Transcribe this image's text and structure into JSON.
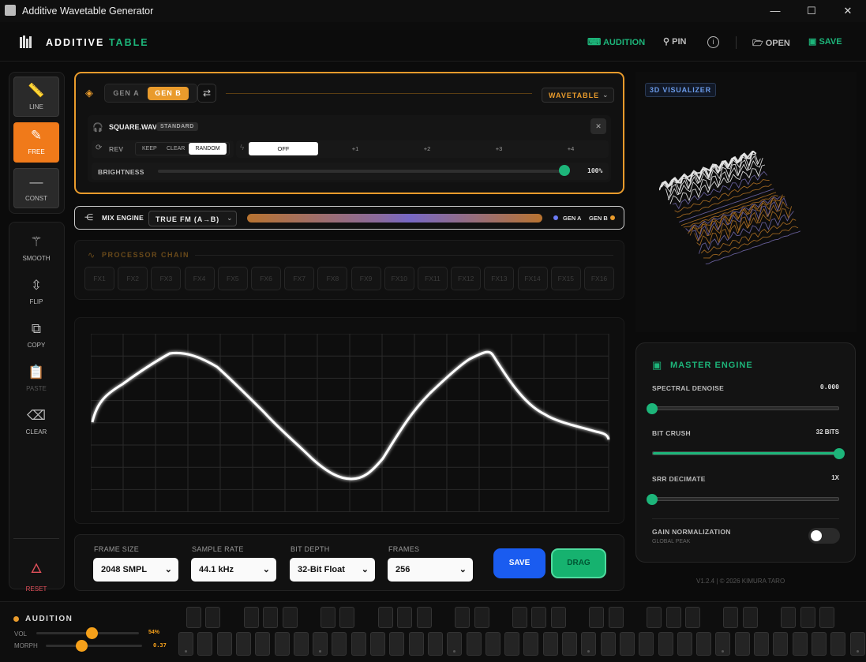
{
  "window": {
    "title": "Additive Wavetable Generator",
    "minimize": "—",
    "maximize": "☐",
    "close": "✕"
  },
  "header": {
    "brand_a": "ADDITIVE",
    "brand_b": "TABLE",
    "audition": "AUDITION",
    "pin": "PIN",
    "info": "i",
    "open": "OPEN",
    "save": "SAVE"
  },
  "toolbar": {
    "modes": [
      {
        "label": "LINE",
        "icon": "ruler-icon"
      },
      {
        "label": "FREE",
        "icon": "pen-icon",
        "active": true
      },
      {
        "label": "CONST",
        "icon": "minus-icon"
      }
    ],
    "actions": [
      {
        "label": "SMOOTH",
        "icon": "wand-icon"
      },
      {
        "label": "FLIP",
        "icon": "flip-icon"
      },
      {
        "label": "COPY",
        "icon": "copy-icon"
      },
      {
        "label": "PASTE",
        "icon": "clipboard-icon",
        "disabled": true
      },
      {
        "label": "CLEAR",
        "icon": "eraser-icon"
      }
    ],
    "reset": "RESET"
  },
  "gen": {
    "gen_a": "GEN A",
    "gen_b": "GEN B",
    "mode": "WAVETABLE",
    "file": "SQUARE.WAV",
    "badge": "STANDARD",
    "rev": "REV",
    "keep": "KEEP",
    "clear": "CLEAR",
    "random": "RANDOM",
    "octaves": [
      "OFF",
      "+1",
      "+2",
      "+3",
      "+4"
    ],
    "brightness_label": "BRIGHTNESS",
    "brightness_value": "100%",
    "brightness": 1.0
  },
  "mix": {
    "label": "MIX ENGINE",
    "mode": "TRUE FM (A→B)",
    "gen_a": "GEN A",
    "gen_b": "GEN B"
  },
  "processor": {
    "title": "PROCESSOR CHAIN",
    "slots": [
      "FX1",
      "FX2",
      "FX3",
      "FX4",
      "FX5",
      "FX6",
      "FX7",
      "FX8",
      "FX9",
      "FX10",
      "FX11",
      "FX12",
      "FX13",
      "FX14",
      "FX15",
      "FX16"
    ]
  },
  "settings": {
    "frame_size_label": "FRAME SIZE",
    "frame_size": "2048 SMPL",
    "sample_rate_label": "SAMPLE RATE",
    "sample_rate": "44.1 kHz",
    "bit_depth_label": "BIT DEPTH",
    "bit_depth": "32-Bit Float",
    "frames_label": "FRAMES",
    "frames": "256",
    "save": "SAVE",
    "drag": "DRAG"
  },
  "visualizer": {
    "label": "3D VISUALIZER"
  },
  "master": {
    "title": "MASTER ENGINE",
    "denoise_label": "SPECTRAL DENOISE",
    "denoise_value": "0.000",
    "denoise": 0.0,
    "crush_label": "BIT CRUSH",
    "crush_value": "32 BITS",
    "crush": 1.0,
    "srr_label": "SRR DECIMATE",
    "srr_value": "1X",
    "srr": 0.0,
    "gain_label": "GAIN NORMALIZATION",
    "gain_sub": "GLOBAL PEAK",
    "gain_on": false
  },
  "footer": "V1.2.4 | © 2026 KIMURA TARO",
  "audition": {
    "title": "AUDITION",
    "vol_label": "VOL",
    "vol_value": "54%",
    "vol": 0.54,
    "morph_label": "MORPH",
    "morph_value": "0.37",
    "morph": 0.37
  },
  "colors": {
    "accent": "#1db57a",
    "orange": "#f07a1a",
    "amber": "#e99b2c",
    "blue": "#1a5cf0"
  }
}
